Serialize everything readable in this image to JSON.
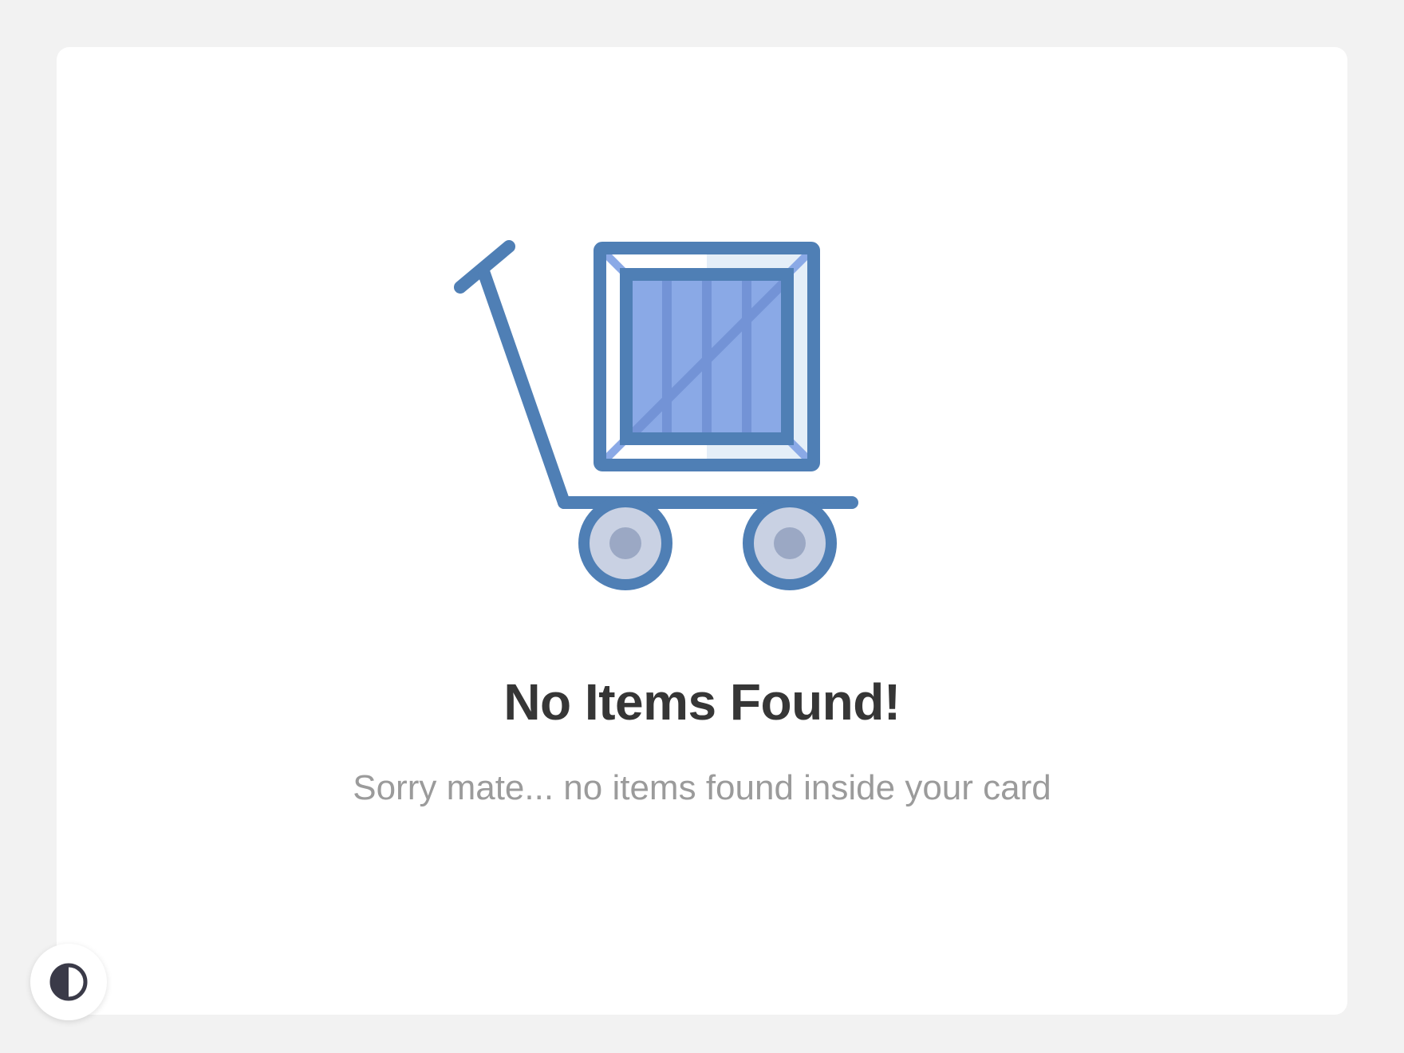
{
  "empty_state": {
    "title": "No Items Found!",
    "message": "Sorry mate... no items found inside your card",
    "illustration_icon": "cart-with-crate-icon"
  },
  "theme_toggle": {
    "icon": "contrast-icon"
  },
  "colors": {
    "page_background": "#f2f2f2",
    "card_background": "#ffffff",
    "title_text": "#363636",
    "message_text": "#9b9b9b",
    "illustration_stroke": "#4f7fb5",
    "crate_fill": "#8aa9e6",
    "wheel_fill": "#c9d1e3",
    "toggle_icon": "#3a3a48"
  }
}
